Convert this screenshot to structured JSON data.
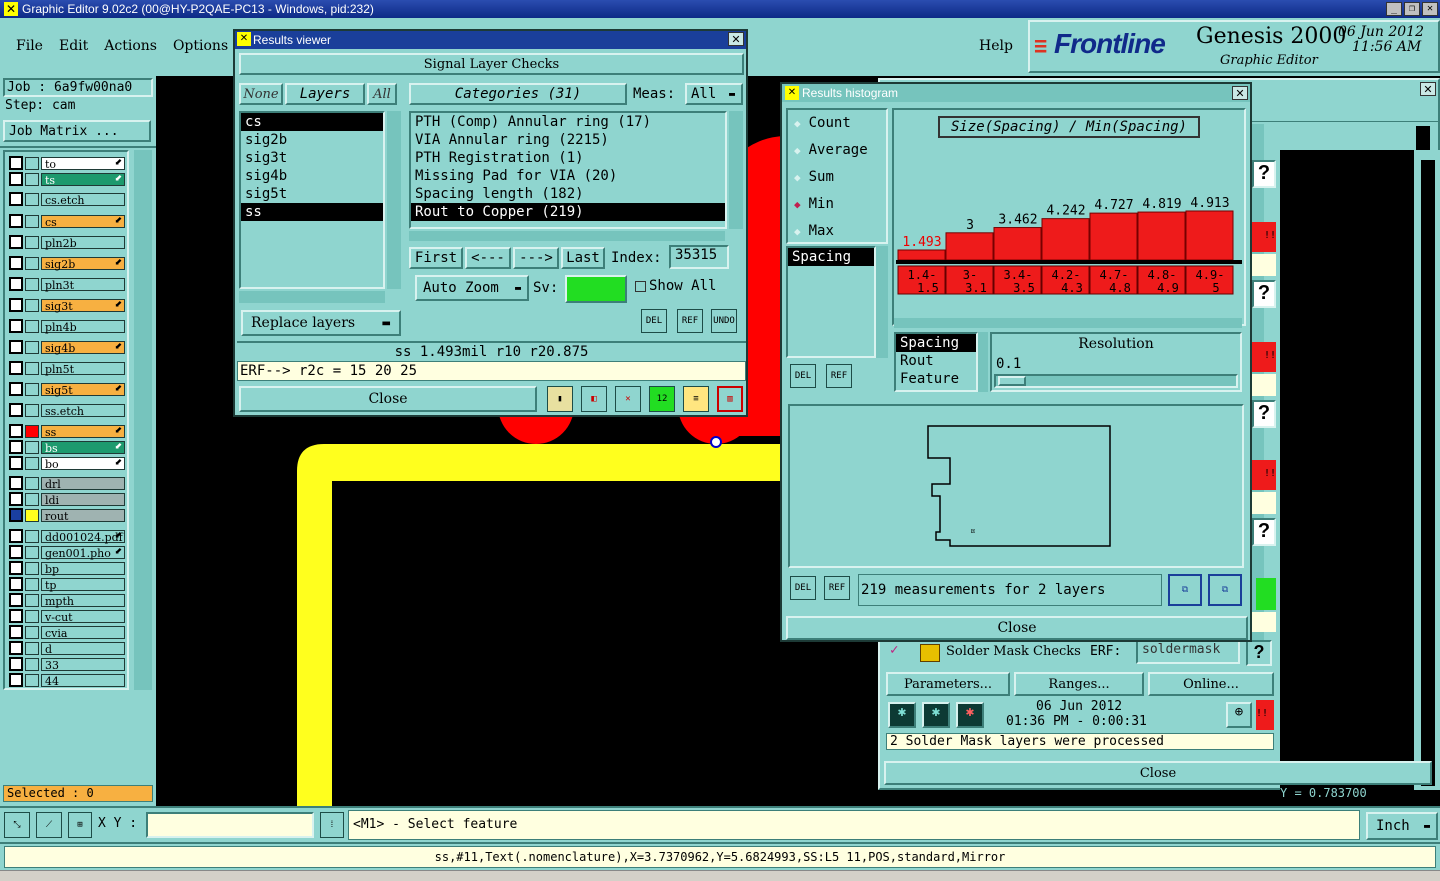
{
  "app": {
    "title": "Graphic Editor 9.02c2 (00@HY-P2QAE-PC13 - Windows, pid:232)",
    "menu": [
      "File",
      "Edit",
      "Actions",
      "Options"
    ],
    "help": "Help",
    "brand": "Frontline",
    "product": "Genesis 2000",
    "subtitle": "Graphic Editor",
    "date": "06 Jun 2012",
    "time": "11:56 AM"
  },
  "left": {
    "job": "Job  :  6a9fw00na0",
    "step": "Step:  cam",
    "job_matrix": "Job Matrix ...",
    "layers": [
      {
        "name": "to",
        "color": "white",
        "arrow": true
      },
      {
        "name": "ts",
        "color": "green",
        "arrow": true
      },
      {
        "name": "cs.etch",
        "color": "teal",
        "arrow": false
      },
      {
        "name": "cs",
        "color": "orange",
        "arrow": true
      },
      {
        "name": "pln2b",
        "color": "teal",
        "arrow": false
      },
      {
        "name": "sig2b",
        "color": "orange",
        "arrow": true
      },
      {
        "name": "pln3t",
        "color": "teal",
        "arrow": false
      },
      {
        "name": "sig3t",
        "color": "orange",
        "arrow": true
      },
      {
        "name": "pln4b",
        "color": "teal",
        "arrow": false
      },
      {
        "name": "sig4b",
        "color": "orange",
        "arrow": true
      },
      {
        "name": "pln5t",
        "color": "teal",
        "arrow": false
      },
      {
        "name": "sig5t",
        "color": "orange",
        "arrow": true
      },
      {
        "name": "ss.etch",
        "color": "teal",
        "arrow": false
      },
      {
        "name": "ss",
        "color": "orange",
        "arrow": true
      },
      {
        "name": "bs",
        "color": "green",
        "arrow": true
      },
      {
        "name": "bo",
        "color": "white",
        "arrow": true
      },
      {
        "name": "drl",
        "color": "grey",
        "arrow": false
      },
      {
        "name": "ldi",
        "color": "grey",
        "arrow": false
      },
      {
        "name": "rout",
        "color": "grey",
        "arrow": false
      },
      {
        "name": "dd001024.pdf",
        "color": "teal",
        "arrow": true
      },
      {
        "name": "gen001.pho",
        "color": "teal",
        "arrow": true
      },
      {
        "name": "bp",
        "color": "teal",
        "arrow": false
      },
      {
        "name": "tp",
        "color": "teal",
        "arrow": false
      },
      {
        "name": "mpth",
        "color": "teal",
        "arrow": false
      },
      {
        "name": "v-cut",
        "color": "teal",
        "arrow": false
      },
      {
        "name": "cvia",
        "color": "teal",
        "arrow": false
      },
      {
        "name": "d",
        "color": "teal",
        "arrow": false
      },
      {
        "name": "33",
        "color": "teal",
        "arrow": false
      },
      {
        "name": "44",
        "color": "teal",
        "arrow": false
      }
    ],
    "selected": "Selected : 0"
  },
  "results_viewer": {
    "title": "Results viewer",
    "header": "Signal Layer Checks",
    "none": "None",
    "layers_label": "Layers",
    "all": "All",
    "categories_label": "Categories (31)",
    "meas_label": "Meas:",
    "meas_value": "All",
    "layers": [
      "cs",
      "sig2b",
      "sig3t",
      "sig4b",
      "sig5t",
      "ss"
    ],
    "categories": [
      "PTH (Comp) Annular ring (17)",
      "VIA Annular ring (2215)",
      "PTH Registration (1)",
      "Missing Pad for VIA (20)",
      "Spacing length (182)",
      "Rout to Copper (219)"
    ],
    "first": "First",
    "prev": "<---",
    "next": "--->",
    "last": "Last",
    "index_label": "Index:",
    "index_value": "35315",
    "replace_layers": "Replace layers",
    "auto_zoom": "Auto Zoom",
    "sv_label": "Sv:",
    "show_all": "Show All",
    "del": "DEL",
    "ref": "REF",
    "undo": "UNDO",
    "measurement": "ss 1.493mil   r10   r20.875",
    "erf": "ERF--> r2c = 15 20 25",
    "close": "Close"
  },
  "histogram": {
    "title": "Results histogram",
    "modes": [
      "Count",
      "Average",
      "Sum",
      "Min",
      "Max"
    ],
    "selected_mode": "Min",
    "plot_title": "Size(Spacing) / Min(Spacing)",
    "list1": [
      "Spacing"
    ],
    "list2": [
      "Spacing",
      "Rout",
      "Feature"
    ],
    "resolution_label": "Resolution",
    "resolution_value": "0.1",
    "summary": "219 measurements for 2 layers",
    "close": "Close",
    "del": "DEL",
    "ref": "REF"
  },
  "chart_data": {
    "type": "bar",
    "title": "Size(Spacing) / Min(Spacing)",
    "categories": [
      "1.4-1.5",
      "3-3.1",
      "3.4-3.5",
      "4.2-4.3",
      "4.7-4.8",
      "4.8-4.9",
      "4.9-5"
    ],
    "values": [
      1.493,
      3,
      3.462,
      4.242,
      4.727,
      4.819,
      4.913
    ],
    "value_labels": [
      "1.493",
      "3",
      "3.462",
      "4.242",
      "4.727",
      "4.819",
      "4.913"
    ],
    "ylim": [
      0,
      5
    ],
    "grid": false,
    "legend": "none",
    "bar_color": "#ee1b1b"
  },
  "drc": {
    "solder_mask": "Solder Mask Checks",
    "erf_label": "ERF:",
    "erf_value": "soldermask",
    "parameters": "Parameters...",
    "ranges": "Ranges...",
    "online": "Online...",
    "run_date": "06 Jun 2012",
    "run_time": "01:36 PM - 0:00:31",
    "status": "2 Solder Mask layers were processed",
    "close": "Close",
    "q": "?",
    "alert": "!!"
  },
  "bottom": {
    "xy_label": "X Y :",
    "xy_value": "",
    "prompt": "<M1> - Select feature",
    "unit": "Inch",
    "status": "ss,#11,Text(.nomenclature),X=3.7370962,Y=5.6824993,SS:L5 11,POS,standard,Mirror",
    "coord_y": "Y = 0.783700"
  },
  "colors": {
    "panel": "#8fd5cf",
    "selected_bg": "#000000",
    "accent_red": "#ee1b1b",
    "trace_yellow": "#ffff1e",
    "pad_red": "#ff0000",
    "sv_green": "#22dd22"
  }
}
